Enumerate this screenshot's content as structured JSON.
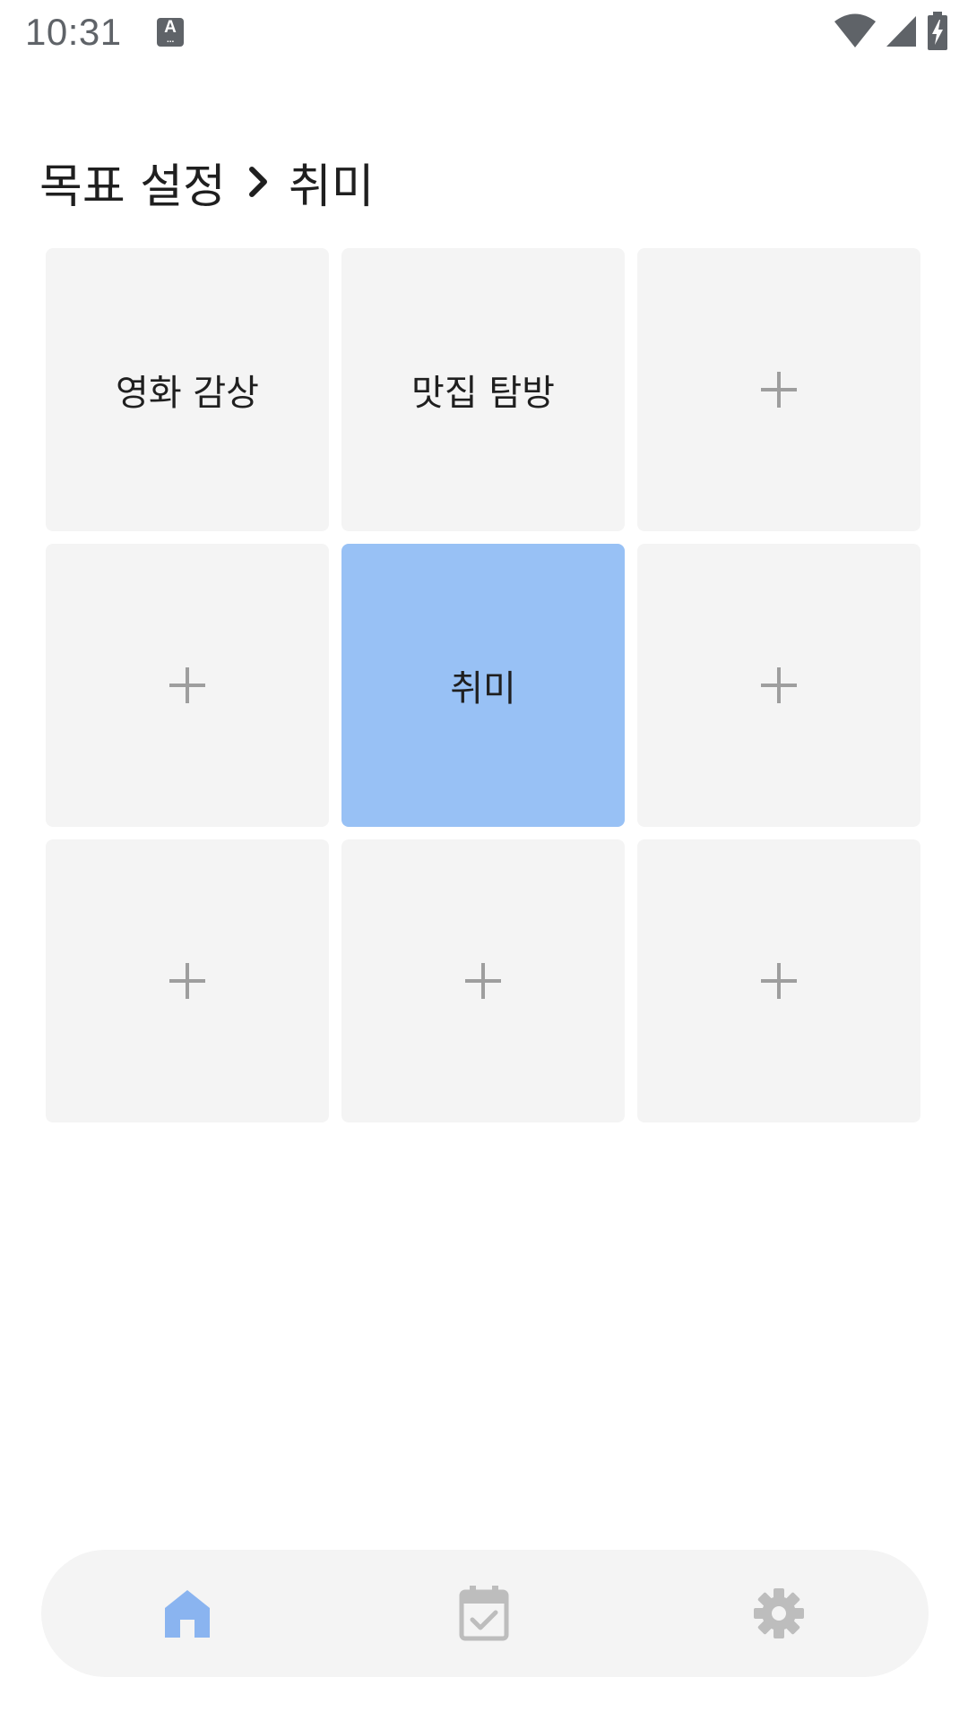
{
  "status_bar": {
    "time": "10:31",
    "notification_icon": "a-icon",
    "right_icons": [
      "wifi-icon",
      "signal-icon",
      "battery-charging-icon"
    ]
  },
  "header": {
    "breadcrumb_parent": "목표 설정",
    "breadcrumb_separator_icon": "chevron-right-icon",
    "breadcrumb_current": "취미"
  },
  "grid": {
    "cells": [
      {
        "label": "영화 감상",
        "type": "goal"
      },
      {
        "label": "맛집 탐방",
        "type": "goal"
      },
      {
        "label": "",
        "type": "add",
        "icon": "plus-icon"
      },
      {
        "label": "",
        "type": "add",
        "icon": "plus-icon"
      },
      {
        "label": "취미",
        "type": "center"
      },
      {
        "label": "",
        "type": "add",
        "icon": "plus-icon"
      },
      {
        "label": "",
        "type": "add",
        "icon": "plus-icon"
      },
      {
        "label": "",
        "type": "add",
        "icon": "plus-icon"
      },
      {
        "label": "",
        "type": "add",
        "icon": "plus-icon"
      }
    ]
  },
  "bottom_nav": {
    "items": [
      {
        "icon": "home-icon",
        "active": true
      },
      {
        "icon": "calendar-check-icon",
        "active": false
      },
      {
        "icon": "gear-icon",
        "active": false
      }
    ]
  },
  "colors": {
    "accent": "#98c1f5",
    "active_icon": "#8ab4f0",
    "inactive_icon": "#bdbdbd",
    "cell_bg": "#f4f4f4",
    "plus": "#9e9e9e"
  }
}
